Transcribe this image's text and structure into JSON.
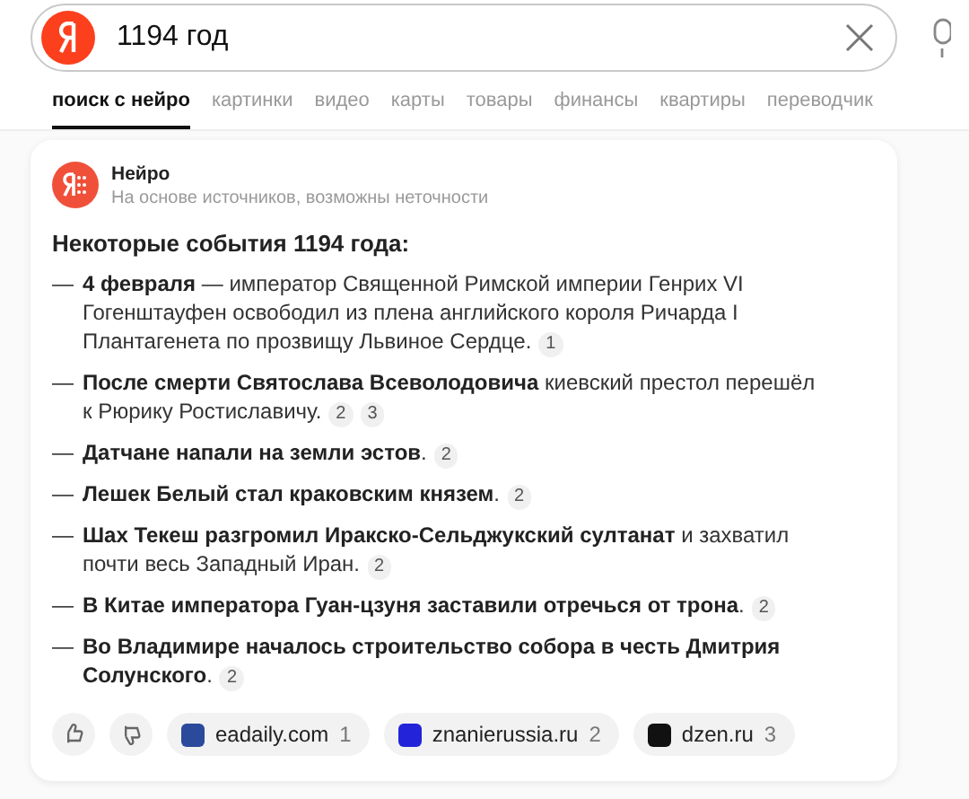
{
  "search": {
    "value": "1194 год"
  },
  "tabs": [
    {
      "label": "поиск с нейро",
      "selected": true
    },
    {
      "label": "картинки",
      "selected": false
    },
    {
      "label": "видео",
      "selected": false
    },
    {
      "label": "карты",
      "selected": false
    },
    {
      "label": "товары",
      "selected": false
    },
    {
      "label": "финансы",
      "selected": false
    },
    {
      "label": "квартиры",
      "selected": false
    },
    {
      "label": "переводчик",
      "selected": false
    }
  ],
  "answer": {
    "source_name": "Нейро",
    "disclaimer": "На основе источников, возможны неточности",
    "heading": "Некоторые события 1194 года:",
    "bullet": "—",
    "items": [
      {
        "text": "**4 февраля** — император Священной Римской империи Генрих VI Гогенштауфен освободил из плена английского короля Ричарда I Плантагенета по прозвищу Львиное Сердце.",
        "refs": [
          "1"
        ]
      },
      {
        "text": "**После смерти Святослава Всеволодовича** киевский престол перешёл к Рюрику Ростиславичу.",
        "refs": [
          "2",
          "3"
        ]
      },
      {
        "text": "**Датчане напали на земли эстов**.",
        "refs": [
          "2"
        ]
      },
      {
        "text": "**Лешек Белый стал краковским князем**.",
        "refs": [
          "2"
        ]
      },
      {
        "text": "**Шах Текеш разгромил Иракско-Сельджукский султанат** и захватил почти весь Западный Иран.",
        "refs": [
          "2"
        ]
      },
      {
        "text": "**В Китае императора Гуан-цзуня заставили отречься от трона**.",
        "refs": [
          "2"
        ]
      },
      {
        "text": "**Во Владимире началось строительство собора в честь Дмитрия Солунского**.",
        "refs": [
          "2"
        ]
      }
    ],
    "sources": [
      {
        "name": "eadaily.com",
        "count": "1",
        "color": "#2b4a9c"
      },
      {
        "name": "znanierussia.ru",
        "count": "2",
        "color": "#2323d9"
      },
      {
        "name": "dzen.ru",
        "count": "3",
        "color": "#111111"
      }
    ]
  }
}
